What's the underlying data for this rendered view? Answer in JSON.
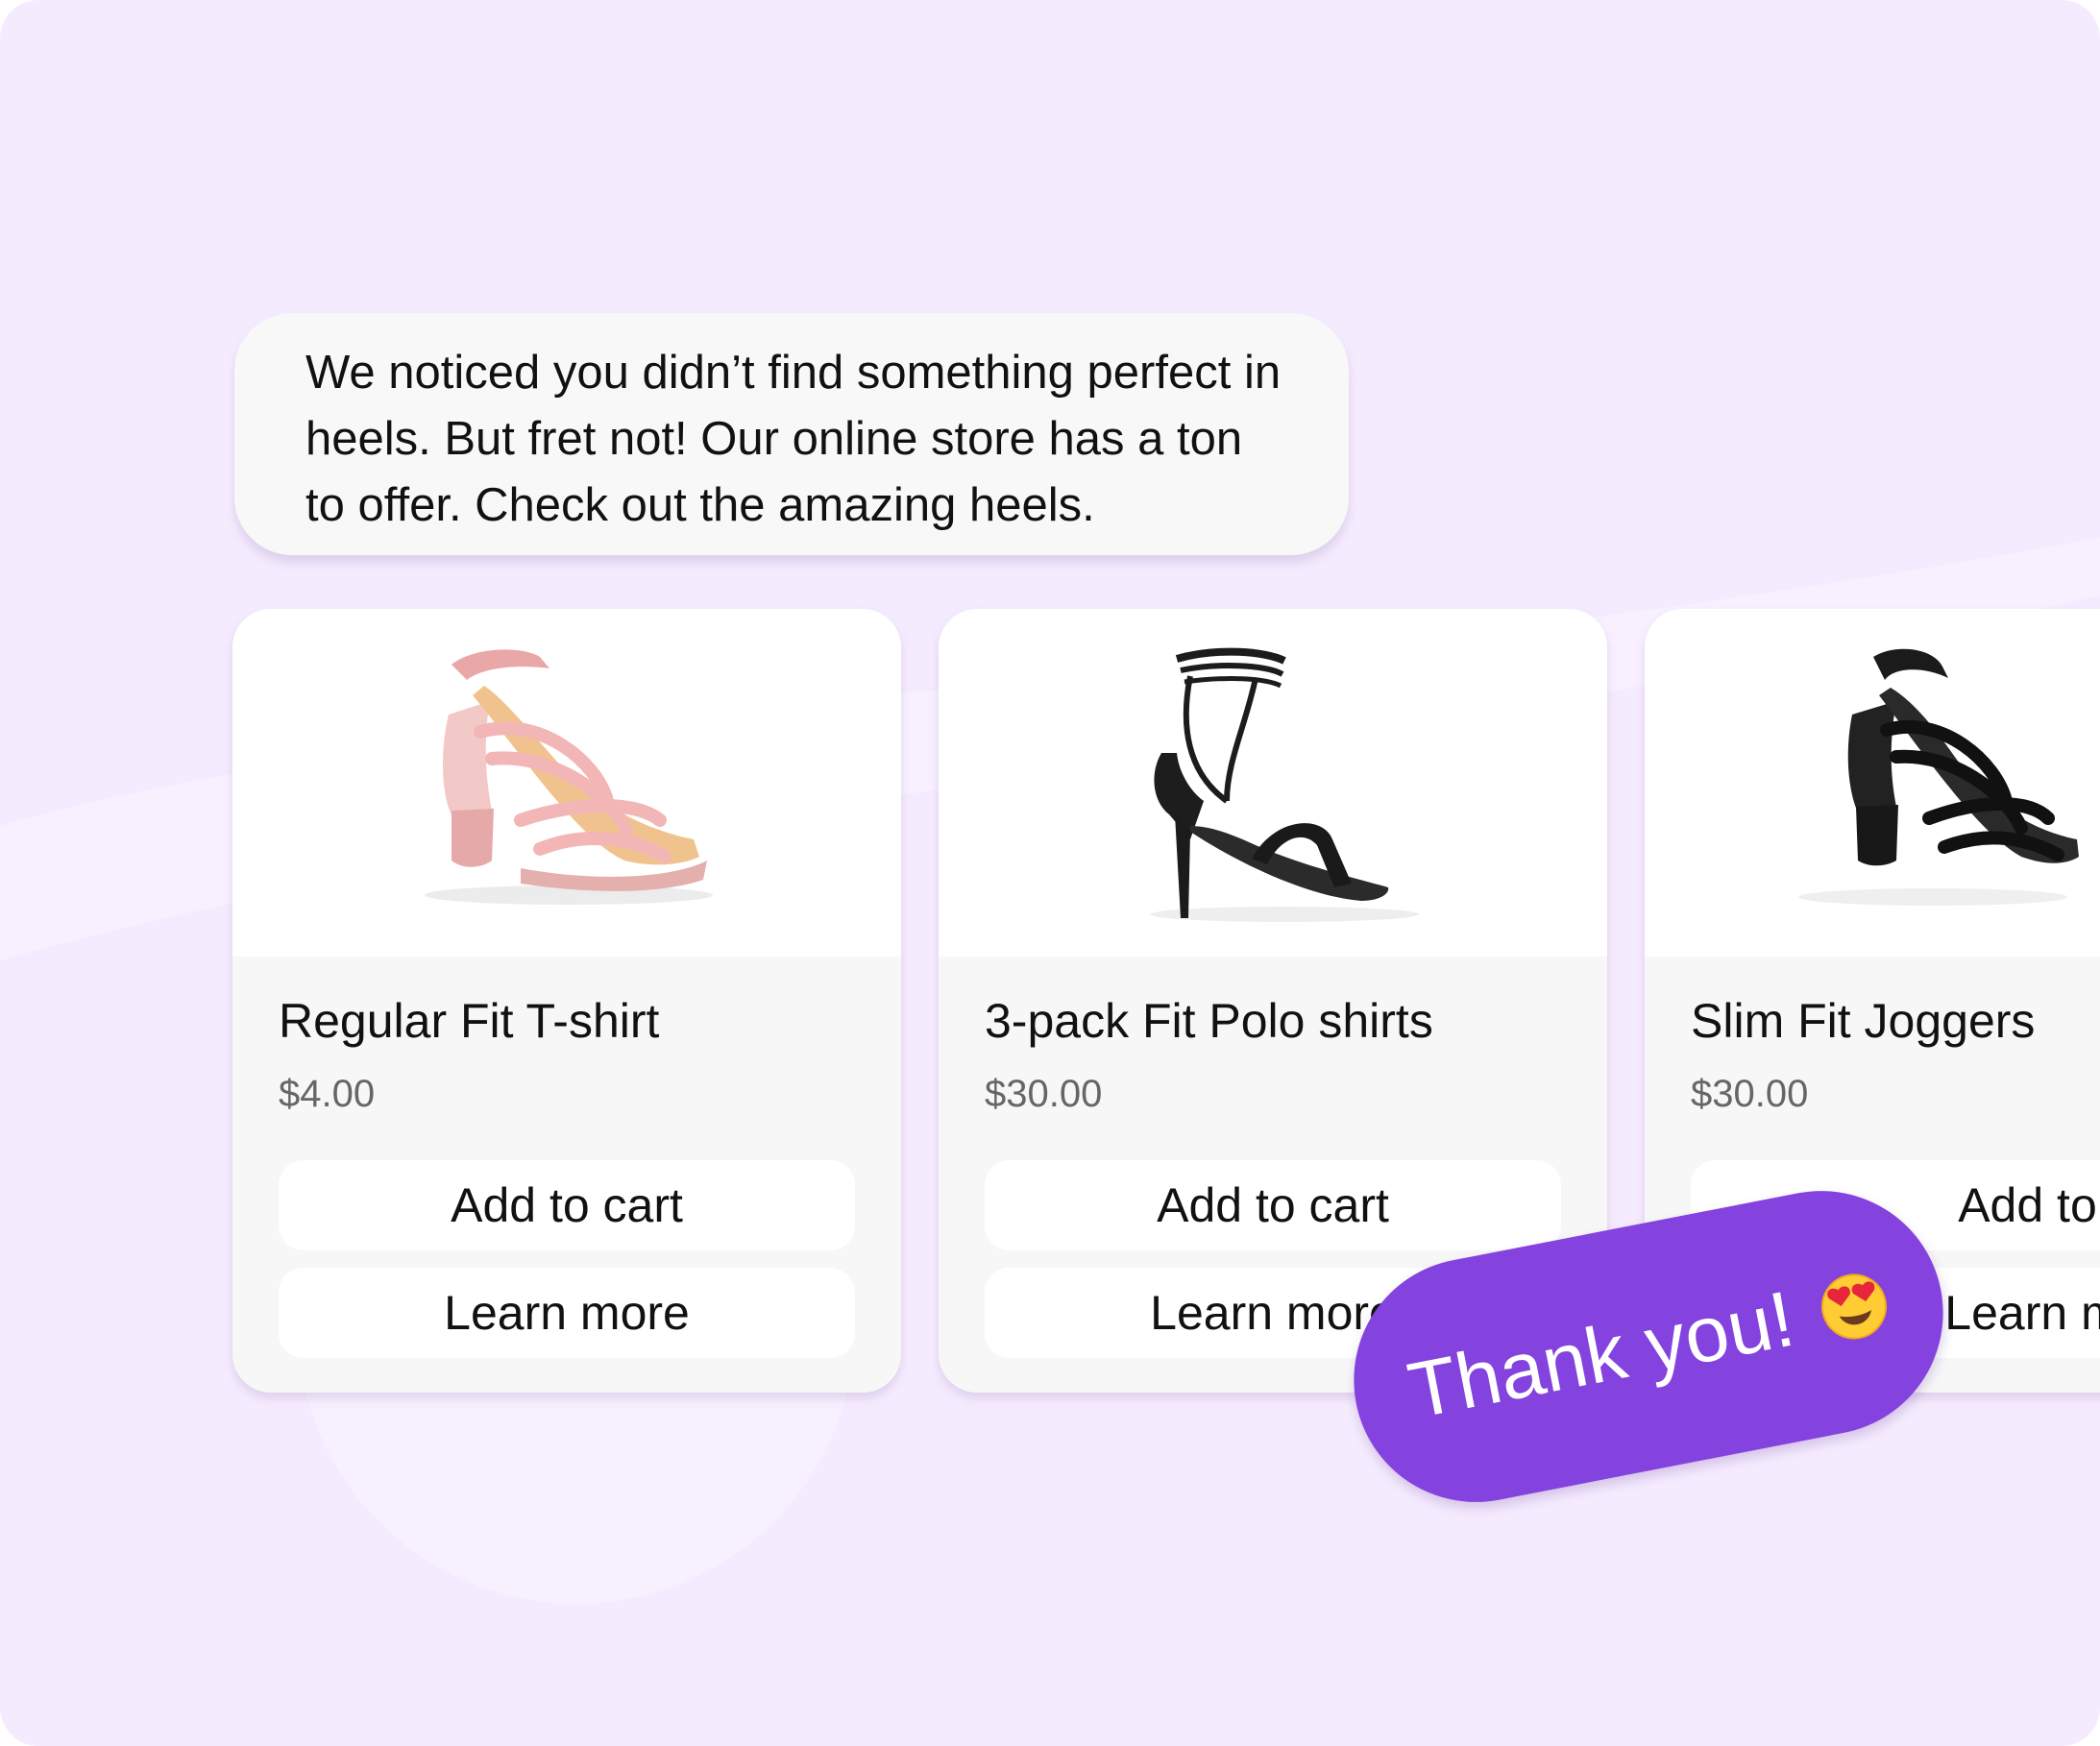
{
  "message": {
    "text": "We noticed you didn’t find something perfect in heels.  But fret not! Our online store has a ton to offer. Check out the amazing heels."
  },
  "products": [
    {
      "title": "Regular Fit T-shirt",
      "price": "$4.00",
      "add_to_cart_label": "Add to cart",
      "learn_more_label": "Learn more",
      "image_icon": "pink-strappy-heel-sandal"
    },
    {
      "title": "3-pack Fit Polo shirts",
      "price": "$30.00",
      "add_to_cart_label": "Add to cart",
      "learn_more_label": "Learn more",
      "image_icon": "black-lace-up-stiletto"
    },
    {
      "title": "Slim Fit Joggers",
      "price": "$30.00",
      "add_to_cart_label": "Add to cart",
      "learn_more_label": "Learn more",
      "image_icon": "black-strappy-heel-sandal"
    }
  ],
  "reply": {
    "text": "Thank you!",
    "emoji_icon": "heart-eyes-emoji"
  },
  "colors": {
    "background": "#f5ebfe",
    "accent": "#8442de",
    "card": "#f7f7f7",
    "price": "#666666"
  }
}
